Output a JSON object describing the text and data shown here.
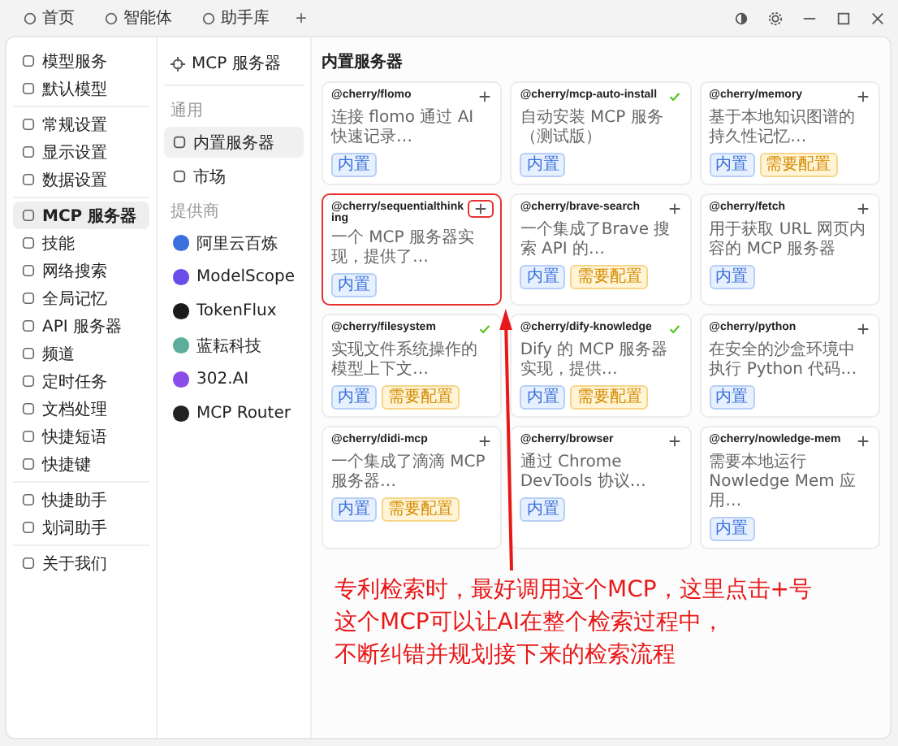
{
  "tabs": [
    {
      "label": "首页",
      "selected": false
    },
    {
      "label": "智能体",
      "selected": false
    },
    {
      "label": "助手库",
      "selected": false
    }
  ],
  "new_tab": "+",
  "sidebar": {
    "groups": [
      [
        {
          "label": "模型服务",
          "selected": false
        },
        {
          "label": "默认模型",
          "selected": false
        }
      ],
      [
        {
          "label": "常规设置",
          "selected": false
        },
        {
          "label": "显示设置",
          "selected": false
        },
        {
          "label": "数据设置",
          "selected": false
        }
      ],
      [
        {
          "label": "MCP 服务器",
          "selected": true
        },
        {
          "label": "技能",
          "selected": false
        },
        {
          "label": "网络搜索",
          "selected": false
        },
        {
          "label": "全局记忆",
          "selected": false
        },
        {
          "label": "API 服务器",
          "selected": false
        },
        {
          "label": "频道",
          "selected": false
        },
        {
          "label": "定时任务",
          "selected": false
        },
        {
          "label": "文档处理",
          "selected": false
        },
        {
          "label": "快捷短语",
          "selected": false
        },
        {
          "label": "快捷键",
          "selected": false
        }
      ],
      [
        {
          "label": "快捷助手",
          "selected": false
        },
        {
          "label": "划词助手",
          "selected": false
        }
      ],
      [
        {
          "label": "关于我们",
          "selected": false
        }
      ]
    ]
  },
  "mcp_nav": {
    "title": "MCP 服务器",
    "sections": [
      {
        "heading": "通用",
        "items": [
          {
            "label": "内置服务器",
            "selected": true
          },
          {
            "label": "市场",
            "selected": false
          }
        ]
      },
      {
        "heading": "提供商",
        "items": [
          {
            "label": "阿里云百炼",
            "selected": false
          },
          {
            "label": "ModelScope",
            "selected": false
          },
          {
            "label": "TokenFlux",
            "selected": false
          },
          {
            "label": "蓝耘科技",
            "selected": false
          },
          {
            "label": "302.AI",
            "selected": false
          },
          {
            "label": "MCP Router",
            "selected": false
          }
        ]
      }
    ]
  },
  "content": {
    "heading": "内置服务器",
    "servers": [
      {
        "name": "@cherry/flomo",
        "description": "连接 flomo 通过 AI 快速记录…",
        "added": false,
        "highlighted": false,
        "tags": [
          {
            "label": "内置",
            "kind": "builtin"
          }
        ]
      },
      {
        "name": "@cherry/mcp-auto-install",
        "description": "自动安装 MCP 服务（测试版）",
        "added": true,
        "highlighted": false,
        "tags": [
          {
            "label": "内置",
            "kind": "builtin"
          }
        ]
      },
      {
        "name": "@cherry/memory",
        "description": "基于本地知识图谱的持久性记忆…",
        "added": false,
        "highlighted": false,
        "tags": [
          {
            "label": "内置",
            "kind": "builtin"
          },
          {
            "label": "需要配置",
            "kind": "config"
          }
        ]
      },
      {
        "name": "@cherry/sequentialthinking",
        "description": "一个 MCP 服务器实现，提供了…",
        "added": false,
        "highlighted": true,
        "tags": [
          {
            "label": "内置",
            "kind": "builtin"
          }
        ]
      },
      {
        "name": "@cherry/brave-search",
        "description": "一个集成了Brave 搜索 API 的…",
        "added": false,
        "highlighted": false,
        "tags": [
          {
            "label": "内置",
            "kind": "builtin"
          },
          {
            "label": "需要配置",
            "kind": "config"
          }
        ]
      },
      {
        "name": "@cherry/fetch",
        "description": "用于获取 URL 网页内容的 MCP 服务器",
        "added": false,
        "highlighted": false,
        "tags": [
          {
            "label": "内置",
            "kind": "builtin"
          }
        ]
      },
      {
        "name": "@cherry/filesystem",
        "description": "实现文件系统操作的模型上下文…",
        "added": true,
        "highlighted": false,
        "tags": [
          {
            "label": "内置",
            "kind": "builtin"
          },
          {
            "label": "需要配置",
            "kind": "config"
          }
        ]
      },
      {
        "name": "@cherry/dify-knowledge",
        "description": "Dify 的 MCP 服务器实现，提供…",
        "added": true,
        "highlighted": false,
        "tags": [
          {
            "label": "内置",
            "kind": "builtin"
          },
          {
            "label": "需要配置",
            "kind": "config"
          }
        ]
      },
      {
        "name": "@cherry/python",
        "description": "在安全的沙盒环境中执行 Python 代码…",
        "added": false,
        "highlighted": false,
        "tags": [
          {
            "label": "内置",
            "kind": "builtin"
          }
        ]
      },
      {
        "name": "@cherry/didi-mcp",
        "description": "一个集成了滴滴 MCP 服务器…",
        "added": false,
        "highlighted": false,
        "tags": [
          {
            "label": "内置",
            "kind": "builtin"
          },
          {
            "label": "需要配置",
            "kind": "config"
          }
        ]
      },
      {
        "name": "@cherry/browser",
        "description": "通过 Chrome DevTools 协议…",
        "added": false,
        "highlighted": false,
        "tags": [
          {
            "label": "内置",
            "kind": "builtin"
          }
        ]
      },
      {
        "name": "@cherry/nowledge-mem",
        "description": "需要本地运行 Nowledge Mem 应用…",
        "added": false,
        "highlighted": false,
        "tags": [
          {
            "label": "内置",
            "kind": "builtin"
          }
        ]
      }
    ]
  },
  "annotation": {
    "lines": [
      "专利检索时，最好调用这个MCP，这里点击+号",
      "这个MCP可以让AI在整个检索过程中，",
      "不断纠错并规划接下来的检索流程"
    ]
  }
}
